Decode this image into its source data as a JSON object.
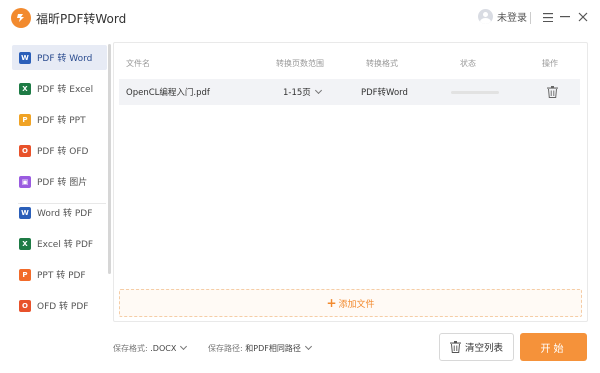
{
  "titlebar": {
    "title": "福昕PDF转Word",
    "login": "未登录",
    "menu_icon": "hamburger-icon",
    "minimize_icon": "minimize-icon",
    "close_icon": "close-icon"
  },
  "sidebar": {
    "items": [
      {
        "label": "PDF 转 Word",
        "icon": "word-icon",
        "color": "#2b5fb9",
        "glyph": "W"
      },
      {
        "label": "PDF 转 Excel",
        "icon": "excel-icon",
        "color": "#1e7b45",
        "glyph": "X"
      },
      {
        "label": "PDF 转 PPT",
        "icon": "ppt-icon",
        "color": "#f0a325",
        "glyph": "P"
      },
      {
        "label": "PDF 转 OFD",
        "icon": "ofd-icon",
        "color": "#e8522b",
        "glyph": "O"
      },
      {
        "label": "PDF 转 图片",
        "icon": "image-icon",
        "color": "#9a5be0",
        "glyph": "▣"
      },
      {
        "label": "Word 转 PDF",
        "icon": "word-icon",
        "color": "#2b5fb9",
        "glyph": "W"
      },
      {
        "label": "Excel 转 PDF",
        "icon": "excel-icon",
        "color": "#1e7b45",
        "glyph": "X"
      },
      {
        "label": "PPT 转 PDF",
        "icon": "ppt-icon",
        "color": "#f26b2a",
        "glyph": "P"
      },
      {
        "label": "OFD 转 PDF",
        "icon": "ofd-icon",
        "color": "#e8522b",
        "glyph": "O"
      }
    ]
  },
  "table": {
    "headers": [
      "文件名",
      "转换页数范围",
      "转换格式",
      "状态",
      "操作"
    ],
    "rows": [
      {
        "filename": "OpenCL编程入门.pdf",
        "range": "1-15页",
        "format": "PDF转Word",
        "progress": 0
      }
    ]
  },
  "add_file": "添加文件",
  "bottom": {
    "save_format_label": "保存格式:",
    "save_format_value": ".DOCX",
    "save_path_label": "保存路径:",
    "save_path_value": "和PDF相同路径",
    "clear_label": "清空列表",
    "start_label": "开始"
  },
  "colors": {
    "accent": "#f5923a",
    "active_bg": "#e7ebf5"
  }
}
